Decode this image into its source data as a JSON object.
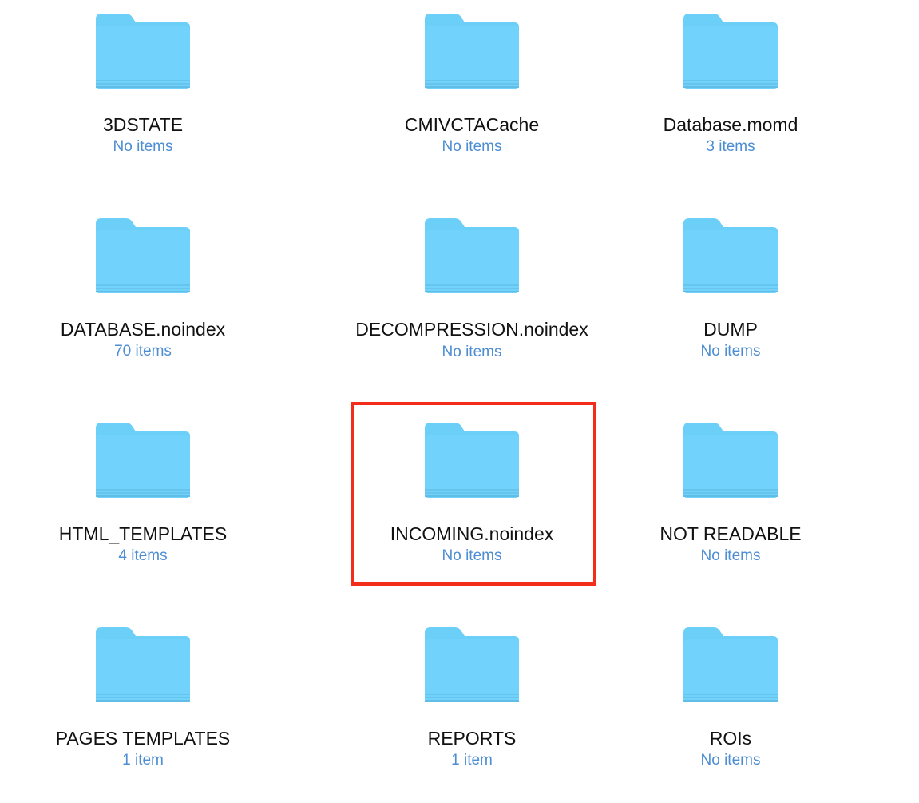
{
  "folders": [
    {
      "name": "3DSTATE",
      "count": "No items"
    },
    {
      "name": "CMIVCTACache",
      "count": "No items"
    },
    {
      "name": "Database.momd",
      "count": "3 items"
    },
    {
      "name": "DATABASE.noindex",
      "count": "70 items"
    },
    {
      "name": "DECOMPRESSION.noindex",
      "count": "No items"
    },
    {
      "name": "DUMP",
      "count": "No items"
    },
    {
      "name": "HTML_TEMPLATES",
      "count": "4 items"
    },
    {
      "name": "INCOMING.noindex",
      "count": "No items"
    },
    {
      "name": "NOT READABLE",
      "count": "No items"
    },
    {
      "name": "PAGES TEMPLATES",
      "count": "1 item"
    },
    {
      "name": "REPORTS",
      "count": "1 item"
    },
    {
      "name": "ROIs",
      "count": "No items"
    }
  ],
  "highlighted_folder": "INCOMING.noindex",
  "colors": {
    "folder_body": "#6ccff8",
    "folder_tab": "#78d2f8",
    "count_text": "#4d8dd3",
    "highlight_border": "#f32d1a"
  },
  "icon": "folder-icon"
}
